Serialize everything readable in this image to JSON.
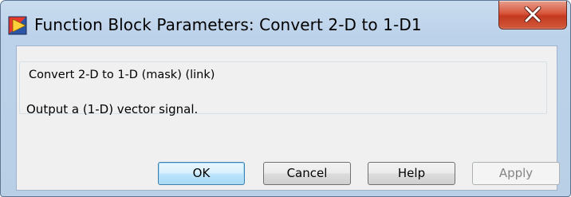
{
  "window": {
    "title": "Function Block Parameters: Convert 2-D to 1-D1"
  },
  "titlebar": {
    "app_icon": "simulink-block-icon",
    "close_icon": "close-x-icon",
    "close_color": "#c8432a"
  },
  "block": {
    "group_title": "Convert 2-D to 1-D (mask) (link)",
    "description": "Output a (1-D) vector signal."
  },
  "buttons": {
    "ok": "OK",
    "cancel": "Cancel",
    "help": "Help",
    "apply": "Apply"
  },
  "colors": {
    "frame": "#bcd2ea",
    "client": "#f0f0f0",
    "default_button_accent": "#3c7fb1"
  }
}
